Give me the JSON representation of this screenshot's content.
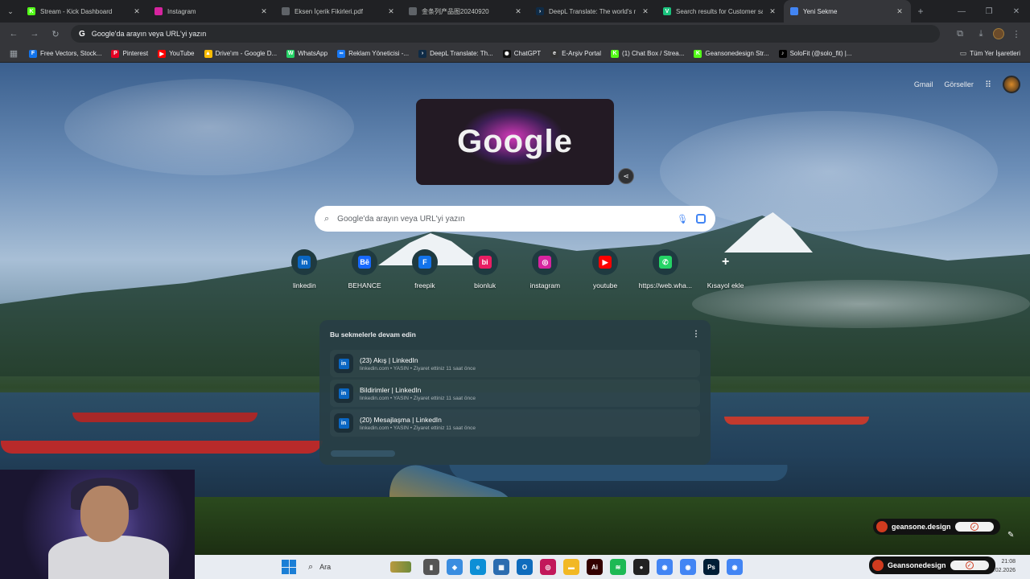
{
  "tabs": [
    {
      "title": "Stream - Kick Dashboard",
      "icon": "kick-icon",
      "color": "#53fc18",
      "glyph": "K",
      "active": false
    },
    {
      "title": "Instagram",
      "icon": "instagram-icon",
      "color": "#d6249f",
      "glyph": "",
      "active": false
    },
    {
      "title": "Eksen İçerik Fikirleri.pdf",
      "icon": "globe-icon",
      "color": "#5f6368",
      "glyph": "",
      "active": false
    },
    {
      "title": "金条列产品图20240920",
      "icon": "globe-icon",
      "color": "#5f6368",
      "glyph": "",
      "active": false
    },
    {
      "title": "DeepL Translate: The world's m",
      "icon": "deepl-icon",
      "color": "#0f2b46",
      "glyph": "›",
      "active": false
    },
    {
      "title": "Search results for Customer sa",
      "icon": "vectorize-icon",
      "color": "#19c37d",
      "glyph": "V",
      "active": false
    },
    {
      "title": "Yeni Sekme",
      "icon": "chrome-icon",
      "color": "#4285f4",
      "glyph": "",
      "active": true
    }
  ],
  "omnibox": {
    "text": "Google'da arayın veya URL'yi yazın"
  },
  "bookmarks": [
    {
      "label": "Free Vectors, Stock...",
      "color": "#1273eb",
      "glyph": "F"
    },
    {
      "label": "Pinterest",
      "color": "#e60023",
      "glyph": "P"
    },
    {
      "label": "YouTube",
      "color": "#ff0000",
      "glyph": "▶"
    },
    {
      "label": "Drive'ım - Google D...",
      "color": "#fbbc04",
      "glyph": "▲"
    },
    {
      "label": "WhatsApp",
      "color": "#25d366",
      "glyph": "W"
    },
    {
      "label": "Reklam Yöneticisi -...",
      "color": "#1877f2",
      "glyph": "∞"
    },
    {
      "label": "DeepL Translate: Th...",
      "color": "#0f2b46",
      "glyph": "›"
    },
    {
      "label": "ChatGPT",
      "color": "#111111",
      "glyph": "✺"
    },
    {
      "label": "E-Arşiv Portal",
      "color": "#333333",
      "glyph": "e"
    },
    {
      "label": "(1) Chat Box / Strea...",
      "color": "#53fc18",
      "glyph": "K"
    },
    {
      "label": "Geansonedesign Str...",
      "color": "#53fc18",
      "glyph": "K"
    },
    {
      "label": "SoloFit (@solo_fit) |...",
      "color": "#000000",
      "glyph": "♪"
    }
  ],
  "bookmarks_all": "Tüm Yer İşaretleri",
  "ntp": {
    "gmail": "Gmail",
    "images": "Görseller",
    "search_placeholder": "Google'da arayın veya URL'yi yazın",
    "doodle_text": "Google"
  },
  "shortcuts": [
    {
      "label": "linkedin",
      "color": "#0a66c2",
      "glyph": "in"
    },
    {
      "label": "BEHANCE",
      "color": "#1769ff",
      "glyph": "Bē"
    },
    {
      "label": "freepik",
      "color": "#1273eb",
      "glyph": "F"
    },
    {
      "label": "bionluk",
      "color": "#e91e63",
      "glyph": "bi"
    },
    {
      "label": "instagram",
      "color": "#d6249f",
      "glyph": "◎"
    },
    {
      "label": "youtube",
      "color": "#ff0000",
      "glyph": "▶"
    },
    {
      "label": "https://web.wha...",
      "color": "#25d366",
      "glyph": "✆"
    }
  ],
  "add_shortcut": "Kısayol ekle",
  "continue": {
    "heading": "Bu sekmelerle devam edin",
    "items": [
      {
        "title": "(23) Akış | LinkedIn",
        "meta": "linkedin.com • YASIN • Ziyaret ettiniz 11 saat önce"
      },
      {
        "title": "Bildirimler | LinkedIn",
        "meta": "linkedin.com • YASIN • Ziyaret ettiniz 11 saat önce"
      },
      {
        "title": "(20) Mesajlaşma | LinkedIn",
        "meta": "linkedin.com • YASIN • Ziyaret ettiniz 11 saat önce"
      }
    ]
  },
  "overlay": {
    "handle_small": "geansone.design",
    "handle_large": "Geansonedesign"
  },
  "taskbar": {
    "search_label": "Ara",
    "apps": [
      {
        "name": "file-explorer-icon",
        "color": "#555555",
        "glyph": "▮"
      },
      {
        "name": "store-icon",
        "color": "#3a8de0",
        "glyph": "◈"
      },
      {
        "name": "edge-icon",
        "color": "#0c8fd6",
        "glyph": "e"
      },
      {
        "name": "calculator-icon",
        "color": "#2b6cb0",
        "glyph": "▦"
      },
      {
        "name": "outlook-icon",
        "color": "#0f6cbd",
        "glyph": "O"
      },
      {
        "name": "app-pink-icon",
        "color": "#c2185b",
        "glyph": "◎"
      },
      {
        "name": "folder-icon",
        "color": "#f2b824",
        "glyph": "▬"
      },
      {
        "name": "illustrator-icon",
        "color": "#330000",
        "glyph": "Ai"
      },
      {
        "name": "spotify-icon",
        "color": "#1db954",
        "glyph": "≋"
      },
      {
        "name": "app-dark-icon",
        "color": "#222222",
        "glyph": "●"
      },
      {
        "name": "chrome-icon",
        "color": "#4285f4",
        "glyph": "◉"
      },
      {
        "name": "chrome-2-icon",
        "color": "#4285f4",
        "glyph": "◉"
      },
      {
        "name": "photoshop-icon",
        "color": "#001e36",
        "glyph": "Ps"
      },
      {
        "name": "chrome-3-icon",
        "color": "#4285f4",
        "glyph": "◉"
      }
    ],
    "time": "21:08",
    "date": "…02.2026"
  }
}
